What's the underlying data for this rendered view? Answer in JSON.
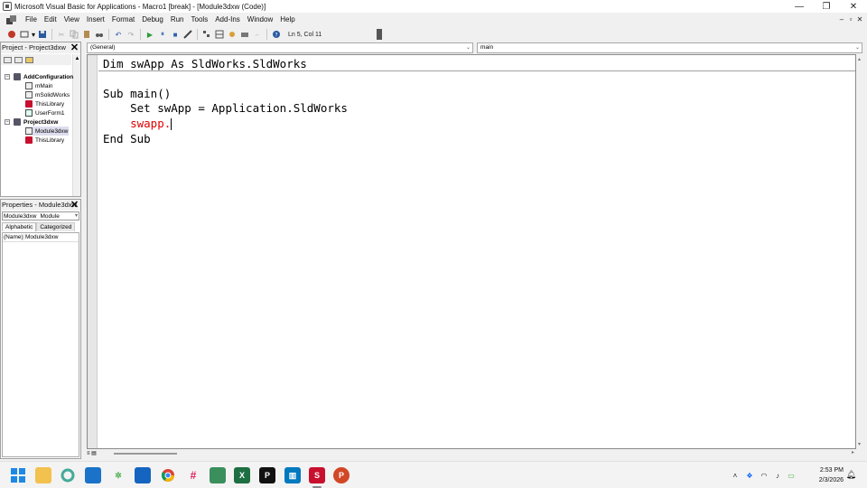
{
  "window": {
    "title": "Microsoft Visual Basic for Applications - Macro1 [break] - [Module3dxw (Code)]",
    "controls": [
      "—",
      "❐",
      "✕"
    ],
    "mdi_controls": [
      "–",
      "▫",
      "✕"
    ]
  },
  "menu": [
    "File",
    "Edit",
    "View",
    "Insert",
    "Format",
    "Debug",
    "Run",
    "Tools",
    "Add-Ins",
    "Window",
    "Help"
  ],
  "toolbar": {
    "status": "Ln 5, Col 11"
  },
  "project_panel": {
    "title": "Project - Project3dxw",
    "tree": [
      {
        "label": "AddConfiguration",
        "bold": true,
        "icon": "project-icon",
        "level": 0
      },
      {
        "label": "mMain",
        "bold": false,
        "icon": "module-icon",
        "level": 1
      },
      {
        "label": "mSolidWorks",
        "bold": false,
        "icon": "module-icon",
        "level": 1
      },
      {
        "label": "ThisLibrary",
        "bold": false,
        "icon": "solidworks-icon",
        "level": 1
      },
      {
        "label": "UserForm1",
        "bold": false,
        "icon": "userform-icon",
        "level": 1
      },
      {
        "label": "Project3dxw",
        "bold": true,
        "icon": "project-icon",
        "level": 0
      },
      {
        "label": "Module3dxw",
        "bold": false,
        "icon": "module-icon",
        "level": 1
      },
      {
        "label": "ThisLibrary",
        "bold": false,
        "icon": "solidworks-icon",
        "level": 1
      }
    ]
  },
  "properties_panel": {
    "title": "Properties - Module3dxw",
    "object_name": "Module3dxw",
    "object_type": "Module",
    "tabs": [
      "Alphabetic",
      "Categorized"
    ],
    "rows": [
      {
        "key": "(Name)",
        "value": "Module3dxw"
      }
    ]
  },
  "code_window": {
    "object_combo": "(General)",
    "proc_combo": "main",
    "lines": [
      "Dim swApp As SldWorks.SldWorks",
      "Sub main()",
      "    Set swApp = Application.SldWorks",
      "    swapp.",
      "End Sub"
    ]
  },
  "taskbar": {
    "time": "2:53 PM",
    "date": "2/3/2026"
  }
}
